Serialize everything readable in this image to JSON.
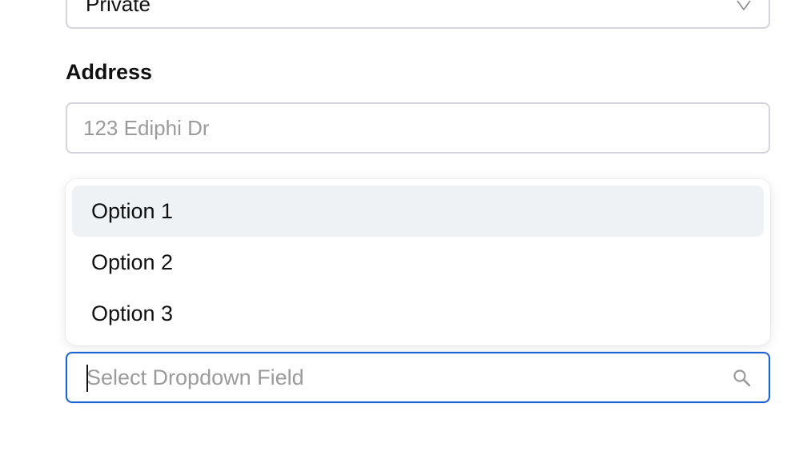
{
  "privacy_select": {
    "value": "Private",
    "icon": "chevron-down-icon"
  },
  "address": {
    "label": "Address",
    "placeholder": "123 Ediphi Dr",
    "value": ""
  },
  "dropdown": {
    "options": [
      "Option 1",
      "Option 2",
      "Option 3"
    ],
    "highlighted_index": 0
  },
  "search_field": {
    "placeholder": "Select Dropdown Field",
    "value": "",
    "icon": "search-icon",
    "focus_color": "#1c64d4"
  }
}
